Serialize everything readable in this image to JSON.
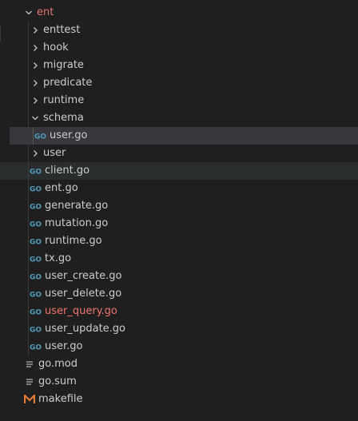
{
  "explorer": {
    "root_folder": {
      "label": "ent",
      "icon": "chevron-down-icon"
    },
    "folders": [
      {
        "label": "enttest",
        "icon": "chevron-right-icon"
      },
      {
        "label": "hook",
        "icon": "chevron-right-icon"
      },
      {
        "label": "migrate",
        "icon": "chevron-right-icon"
      },
      {
        "label": "predicate",
        "icon": "chevron-right-icon"
      },
      {
        "label": "runtime",
        "icon": "chevron-right-icon"
      }
    ],
    "schema_folder": {
      "label": "schema",
      "icon": "chevron-down-icon"
    },
    "schema_file": {
      "label": "user.go",
      "icon": "go-file-icon"
    },
    "user_folder": {
      "label": "user",
      "icon": "chevron-right-icon"
    },
    "go_files": [
      {
        "label": "client.go",
        "icon": "go-file-icon"
      },
      {
        "label": "ent.go",
        "icon": "go-file-icon"
      },
      {
        "label": "generate.go",
        "icon": "go-file-icon"
      },
      {
        "label": "mutation.go",
        "icon": "go-file-icon"
      },
      {
        "label": "runtime.go",
        "icon": "go-file-icon"
      },
      {
        "label": "tx.go",
        "icon": "go-file-icon"
      },
      {
        "label": "user_create.go",
        "icon": "go-file-icon"
      },
      {
        "label": "user_delete.go",
        "icon": "go-file-icon"
      },
      {
        "label": "user_query.go",
        "icon": "go-file-icon"
      },
      {
        "label": "user_update.go",
        "icon": "go-file-icon"
      },
      {
        "label": "user.go",
        "icon": "go-file-icon"
      }
    ],
    "root_files": [
      {
        "label": "go.mod",
        "icon": "lines-file-icon"
      },
      {
        "label": "go.sum",
        "icon": "lines-file-icon"
      },
      {
        "label": "makefile",
        "icon": "makefile-icon"
      }
    ]
  },
  "colors": {
    "background": "#1f1f1f",
    "selected_row": "#37373d",
    "hover_row": "#2a2d2e",
    "go_icon": "#519aba",
    "error_text": "#f0746b",
    "makefile_icon": "#e37933"
  }
}
